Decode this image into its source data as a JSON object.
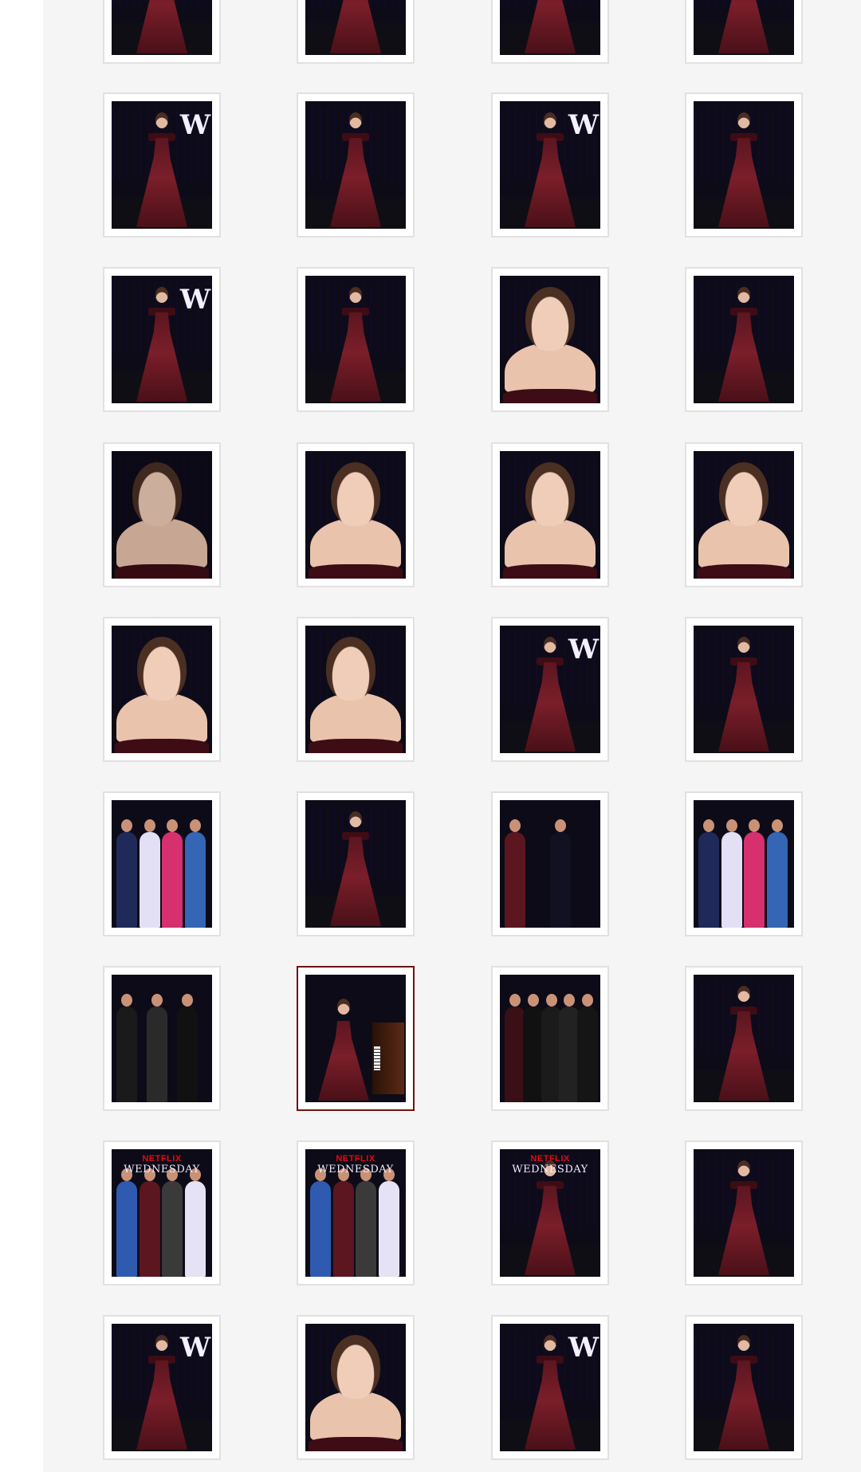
{
  "gallery": {
    "rows": [
      [
        "dress-full",
        "dress-full",
        "dress-full",
        "dress-full"
      ],
      [
        "dress-full",
        "dress-full",
        "dress-full",
        "dress-full"
      ],
      [
        "dress-full",
        "dress-full",
        "portrait",
        "dress-full"
      ],
      [
        "back-portrait",
        "portrait",
        "portrait",
        "portrait"
      ],
      [
        "portrait",
        "portrait-side",
        "dress-full",
        "dress-full"
      ],
      [
        "group",
        "dress-full",
        "duo",
        "group"
      ],
      [
        "bw-group",
        "piano",
        "crowd",
        "dress-stage"
      ],
      [
        "group-banner",
        "group-banner",
        "dress-banner",
        "dress-stage"
      ],
      [
        "dress-full",
        "portrait",
        "dress-full",
        "dress-full"
      ]
    ],
    "selected_index": 25,
    "banner_brand": "NETFLIX",
    "banner_title": "WEDNESDAY",
    "letter_mark": "W",
    "selected_border_color": "#6e1414"
  }
}
